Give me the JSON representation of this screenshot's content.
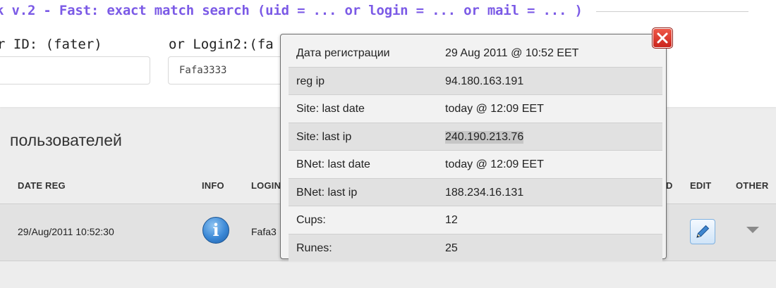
{
  "search": {
    "title": "к v.2 - Fast: exact match search (uid = ... or login = ... or mail = ... )",
    "id_label": "r ID: (fater)",
    "login_label": "or Login2:(fa",
    "id_value": "",
    "login_value": "Fafa3333"
  },
  "users": {
    "heading": "пользователей",
    "columns": [
      "DATE REG",
      "INFO",
      "LOGIN",
      "EDIT",
      "OTHER"
    ],
    "column_fragment": "D",
    "row": {
      "date_reg": "29/Aug/2011 10:52:30",
      "login": "Fafa3"
    }
  },
  "popup": {
    "rows": [
      {
        "key": "Дата регистрации",
        "value": "29 Aug 2011 @ 10:52 EET"
      },
      {
        "key": "reg ip",
        "value": "94.180.163.191"
      },
      {
        "key": "Site: last date",
        "value": "today @ 12:09 EET"
      },
      {
        "key": "Site: last ip",
        "value": "240.190.213.76"
      },
      {
        "key": "BNet: last date",
        "value": "today @ 12:09 EET"
      },
      {
        "key": "BNet: last ip",
        "value": "188.234.16.131"
      },
      {
        "key": "Cups:",
        "value": "12"
      },
      {
        "key": "Runes:",
        "value": "25"
      }
    ]
  },
  "icons": {
    "info": "info-icon",
    "edit": "pencil-icon",
    "other": "caret-down-icon",
    "close": "close-icon"
  },
  "colors": {
    "title": "#7b5ae6",
    "close_button": "#e03a2c",
    "info_button": "#3b88d6"
  }
}
